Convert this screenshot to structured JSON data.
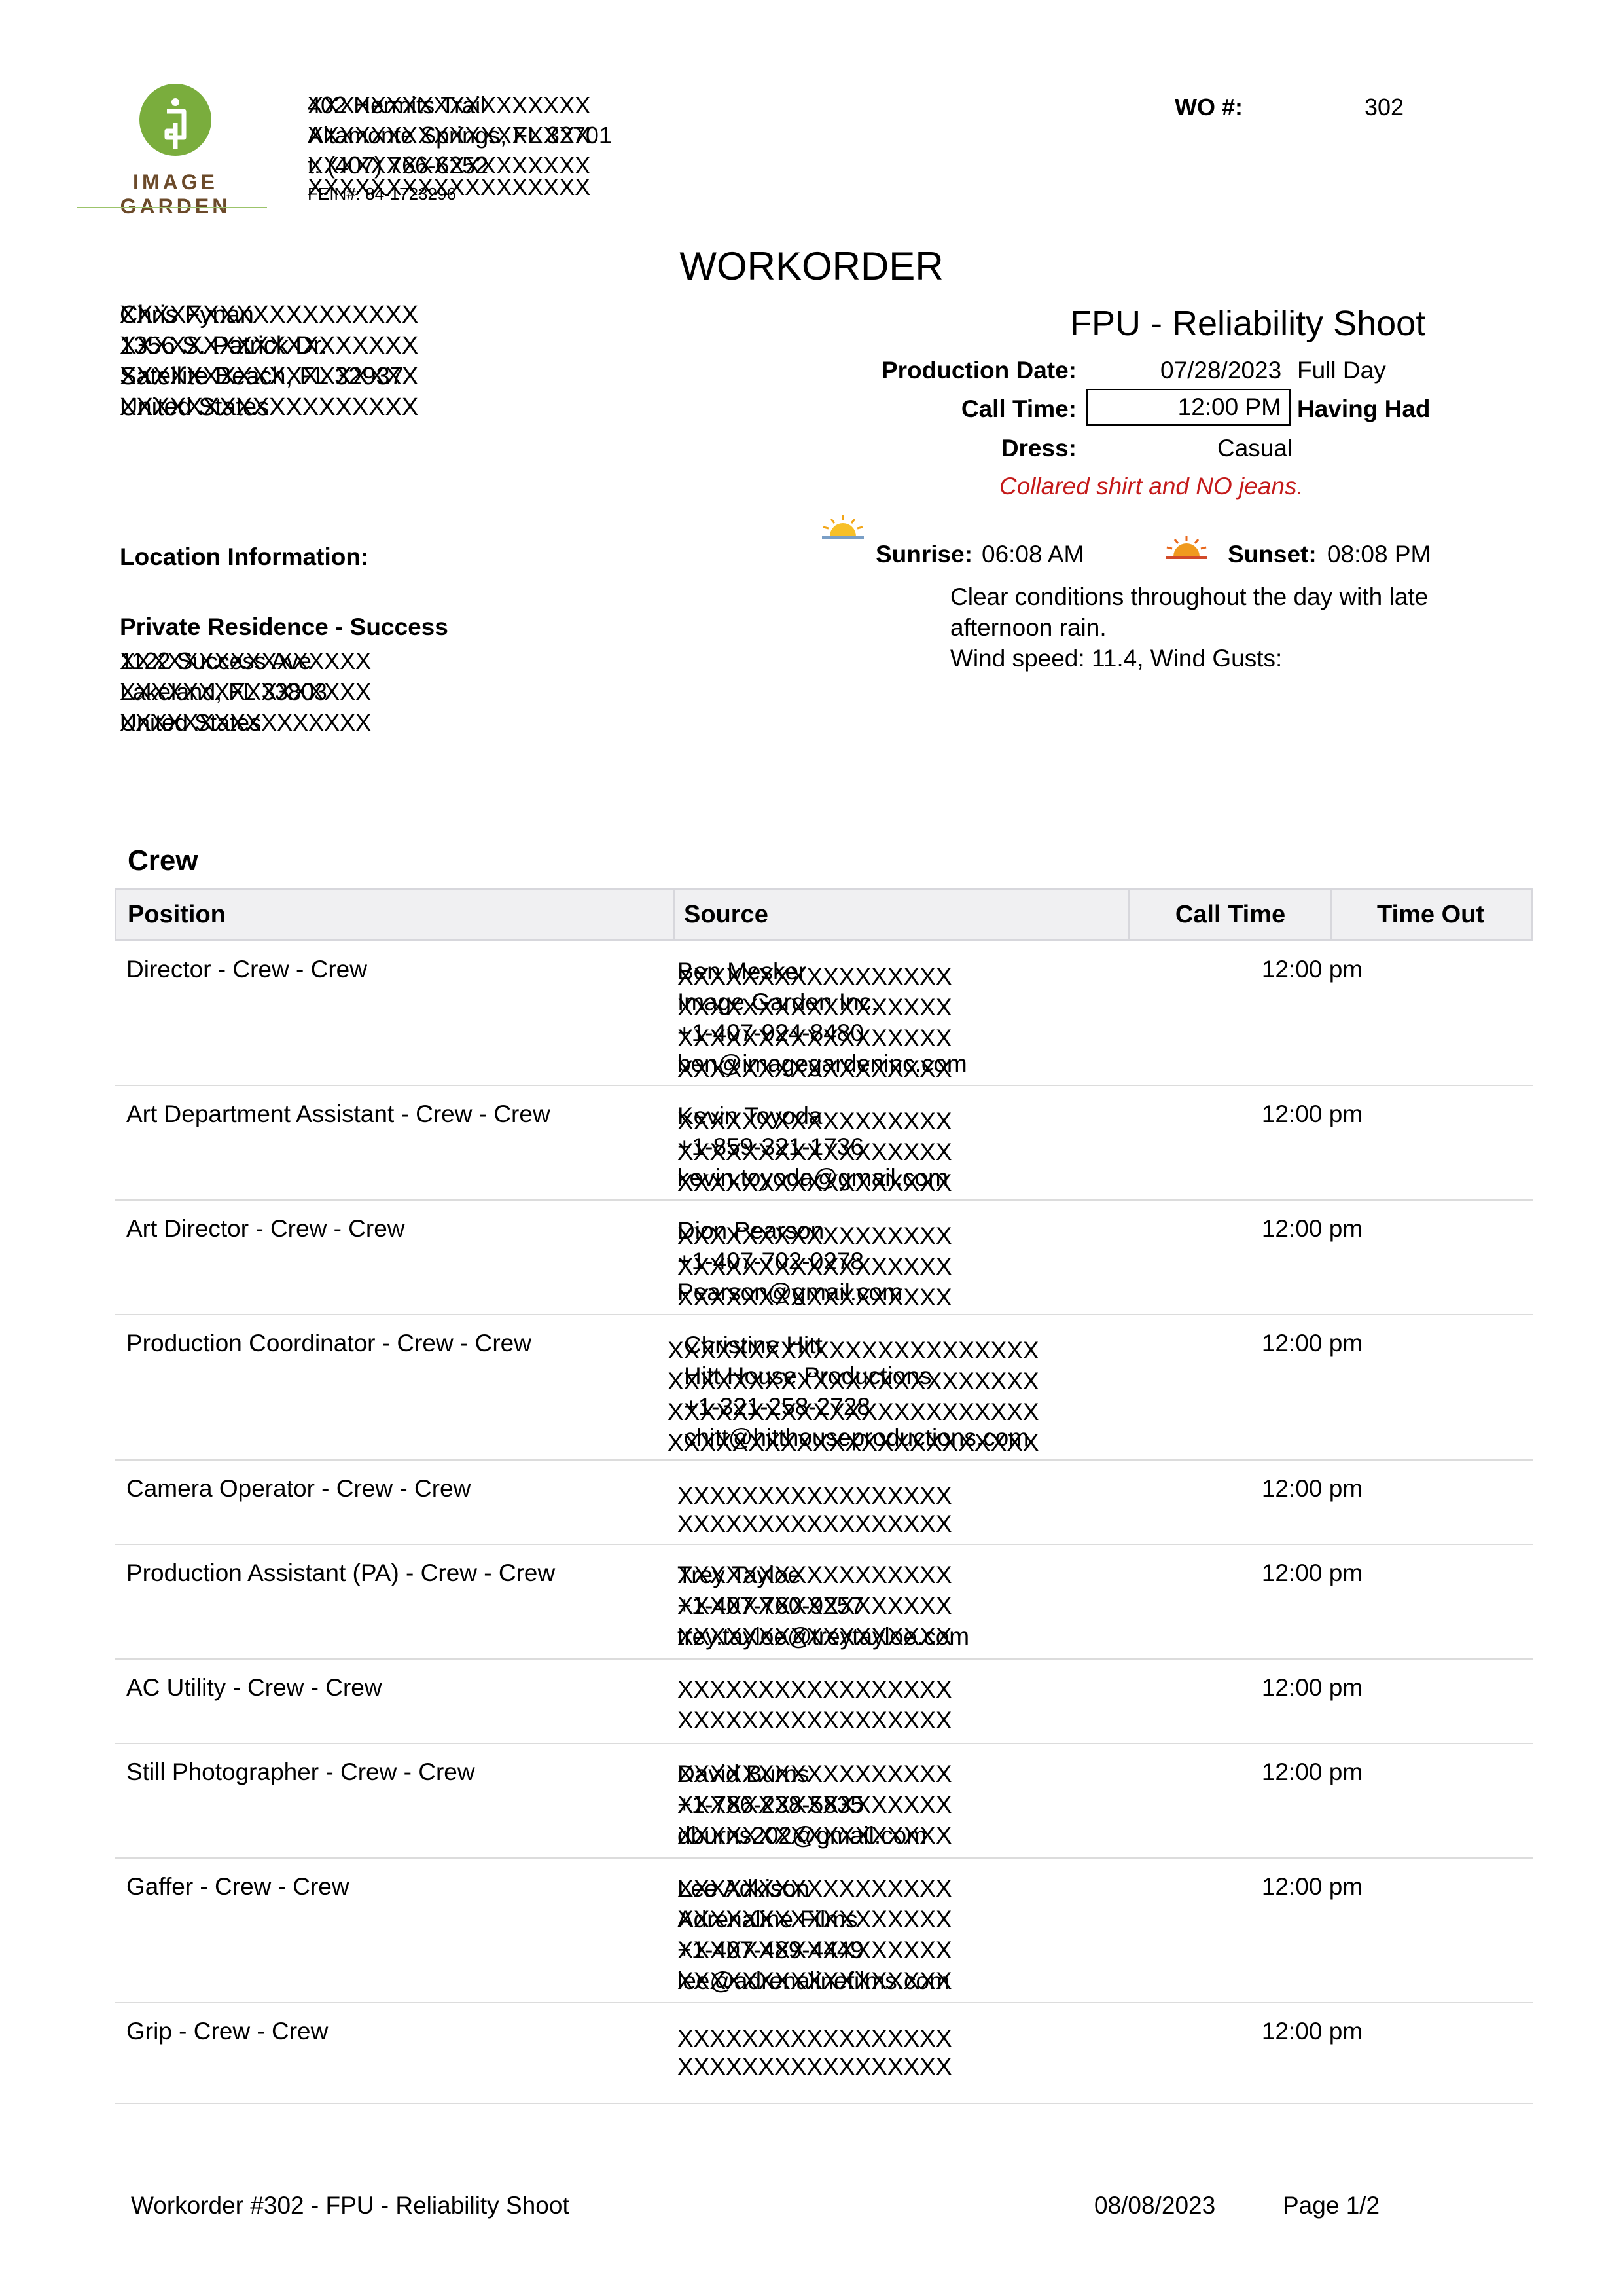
{
  "logo": {
    "text": "IMAGE GARDEN",
    "color": "#7aad3d"
  },
  "company": {
    "lines": [
      "402 Hermits Trail",
      "Altamonte Springs, FL 32701",
      "t: (407) 766-6252",
      "FEIN#: 84-1723296"
    ],
    "redactions": [
      "XXXXXXXXXXXXXXXXXX",
      "XXXXXXXXXXXXXXXXXX",
      "XXXXXXXXXXXXXXXXXX",
      "XXXXXXXXXXXXXXXXXX"
    ]
  },
  "wo": {
    "label": "WO #:",
    "number": "302"
  },
  "title": "WORKORDER",
  "client": {
    "lines": [
      "Chris Fynan",
      "1356 S. Patrick Dr.",
      "Satellite Beach, FL 32937",
      "United States"
    ],
    "redactions": [
      "XXXXXXXXXXXXXXXXXX",
      "XXXXXXXXXXXXXXXXXX",
      "XXXXXXXXXXXXXXXXXX",
      "XXXXXXXXXXXXXXXXXX"
    ]
  },
  "project": {
    "name": "FPU - Reliability Shoot",
    "production_date_label": "Production Date:",
    "production_date": "07/28/2023",
    "day_type": "Full Day",
    "call_time_label": "Call Time:",
    "call_time": "12:00 PM",
    "call_note": "Having Had",
    "dress_label": "Dress:",
    "dress": "Casual",
    "dress_note": "Collared shirt and NO jeans."
  },
  "sun": {
    "sunrise_label": "Sunrise:",
    "sunrise": "06:08 AM",
    "sunset_label": "Sunset:",
    "sunset": "08:08 PM"
  },
  "weather": {
    "line1": "Clear conditions throughout the day with late",
    "line2": "afternoon rain.",
    "line3": "Wind speed: 11.4, Wind Gusts:"
  },
  "location": {
    "title": "Location Information:",
    "name": "Private Residence - Success",
    "lines": [
      "1122 Success Ave",
      "Lakeland, FL 33803",
      "United States"
    ],
    "redactions": [
      "XXXXXXXXXXXXXXXX",
      "XXXXXXXXXXXXXXXX",
      "XXXXXXXXXXXXXXXX"
    ]
  },
  "crew": {
    "title": "Crew",
    "headers": {
      "position": "Position",
      "source": "Source",
      "call_time": "Call Time",
      "time_out": "Time Out"
    },
    "rows": [
      {
        "position": "Director - Crew - Crew",
        "source": [
          "Ben Mesker",
          "Image Garden Inc.",
          "+1-407-924-8480",
          "ben@imagegardeninc.com"
        ],
        "x": [
          "XXXXXXXXXXXXXXXXX",
          "XXXXXXXXXXXXXXXXX",
          "XXXXXXXXXXXXXXXXX",
          "XXXXXXXXXXXXXXXXX"
        ],
        "call": "12:00 pm"
      },
      {
        "position": "Art Department Assistant - Crew - Crew",
        "source": [
          "Kevin Toyoda",
          "+1-859-321-1736",
          "kevin.toyoda@gmail.com"
        ],
        "x": [
          "XXXXXXXXXXXXXXXXX",
          "XXXXXXXXXXXXXXXXX",
          "XXXXXXXXXXXXXXXXX"
        ],
        "call": "12:00 pm"
      },
      {
        "position": "Art Director - Crew - Crew",
        "source": [
          "Dion Pearson",
          "+1-407-702-0278",
          "Pearson@gmail.com"
        ],
        "x": [
          "XXXXXXXXXXXXXXXXX",
          "XXXXXXXXXXXXXXXXX",
          "XXXXXXXXXXXXXXXXX"
        ],
        "call": "12:00 pm"
      },
      {
        "position": "Production Coordinator - Crew - Crew",
        "source": [
          "Christine Hitt",
          "Hitt House Productions",
          "+1-321-258-2728",
          "chitt@hitthouseproductions.com"
        ],
        "x": [
          "XXXXXXXXXXXXXXXXXXXXXXX",
          "XXXXXXXXXXXXXXXXXXXXXXX",
          "XXXXXXXXXXXXXXXXXXXXXXX",
          "XXXXXXXXXXXXXXXXXXXXXXX"
        ],
        "call": "12:00 pm"
      },
      {
        "position": "Camera Operator - Crew - Crew",
        "source": [
          "",
          ""
        ],
        "x": [
          "XXXXXXXXXXXXXXXXX",
          "XXXXXXXXXXXXXXXXX"
        ],
        "call": "12:00 pm"
      },
      {
        "position": "Production Assistant (PA) - Crew - Crew",
        "source": [
          "Trey Tayloe",
          "+1-407-760-9257",
          "trey.tayloe@treytayloe.com"
        ],
        "x": [
          "XXXXXXXXXXXXXXXXX",
          "XXXXXXXXXXXXXXXXX",
          "XXXXXXXXXXXXXXXXX"
        ],
        "call": "12:00 pm"
      },
      {
        "position": "AC Utility - Crew - Crew",
        "source": [
          "",
          ""
        ],
        "x": [
          "XXXXXXXXXXXXXXXXX",
          "XXXXXXXXXXXXXXXXX"
        ],
        "call": "12:00 pm"
      },
      {
        "position": "Still Photographer - Crew - Crew",
        "source": [
          "David Burns",
          "+1-786-238-5835",
          "dburns202@gmail.com"
        ],
        "x": [
          "XXXXXXXXXXXXXXXXX",
          "XXXXXXXXXXXXXXXXX",
          "XXXXXXXXXXXXXXXXX"
        ],
        "call": "12:00 pm"
      },
      {
        "position": "Gaffer - Crew - Crew",
        "source": [
          "Lee Adkison",
          "Adrenaline Films",
          "+1-407-489-4449",
          "lee@adrenalinefilms.com"
        ],
        "x": [
          "XXXXXXXXXXXXXXXXX",
          "XXXXXXXXXXXXXXXXX",
          "XXXXXXXXXXXXXXXXX",
          "XXXXXXXXXXXXXXXXX"
        ],
        "call": "12:00 pm"
      },
      {
        "position": "Grip - Crew - Crew",
        "source": [
          "",
          ""
        ],
        "x": [
          "XXXXXXXXXXXXXXXXX",
          "XXXXXXXXXXXXXXXXX"
        ],
        "call": "12:00 pm"
      }
    ]
  },
  "footer": {
    "left": "Workorder #302 - FPU - Reliability Shoot",
    "date": "08/08/2023",
    "page": "Page 1/2"
  }
}
